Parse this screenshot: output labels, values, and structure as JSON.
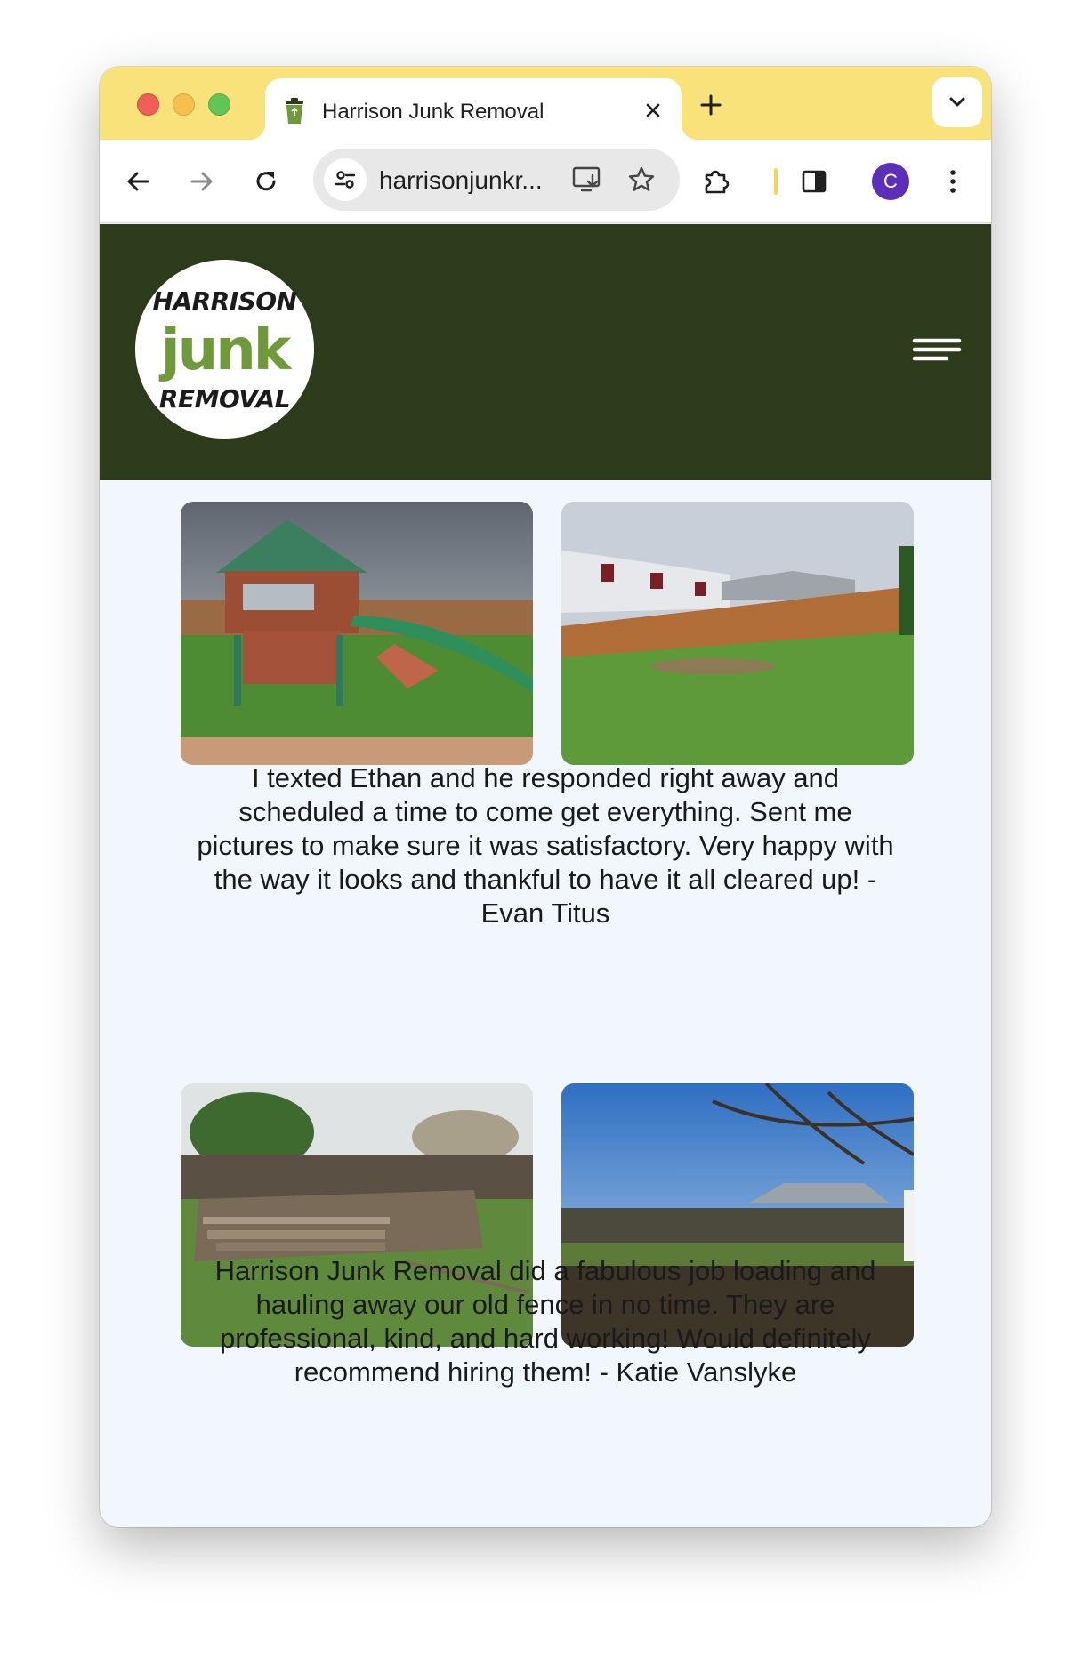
{
  "browser": {
    "tab_title": "Harrison Junk Removal",
    "url_display": "harrisonjunkr...",
    "profile_initial": "C"
  },
  "site": {
    "logo": {
      "line1": "HARRISON",
      "line2_a": "ju",
      "line2_b": "nk",
      "line3": "REMOVAL"
    },
    "colors": {
      "header_bg": "#2c3b1a",
      "page_bg": "#f1f7fd",
      "brand_green": "#6f9a3a"
    }
  },
  "testimonials": [
    {
      "text": "I texted Ethan and he responded right away and scheduled a time to come get everything. Sent me pictures to make sure it was satisfactory. Very happy with the way it looks and thankful to have it all cleared up! - Evan Titus"
    },
    {
      "text": "Harrison Junk Removal did a fabulous job loading and hauling away our old fence in no time. They are professional, kind, and hard working! Would definitely recommend hiring them! - Katie Vanslyke"
    }
  ]
}
